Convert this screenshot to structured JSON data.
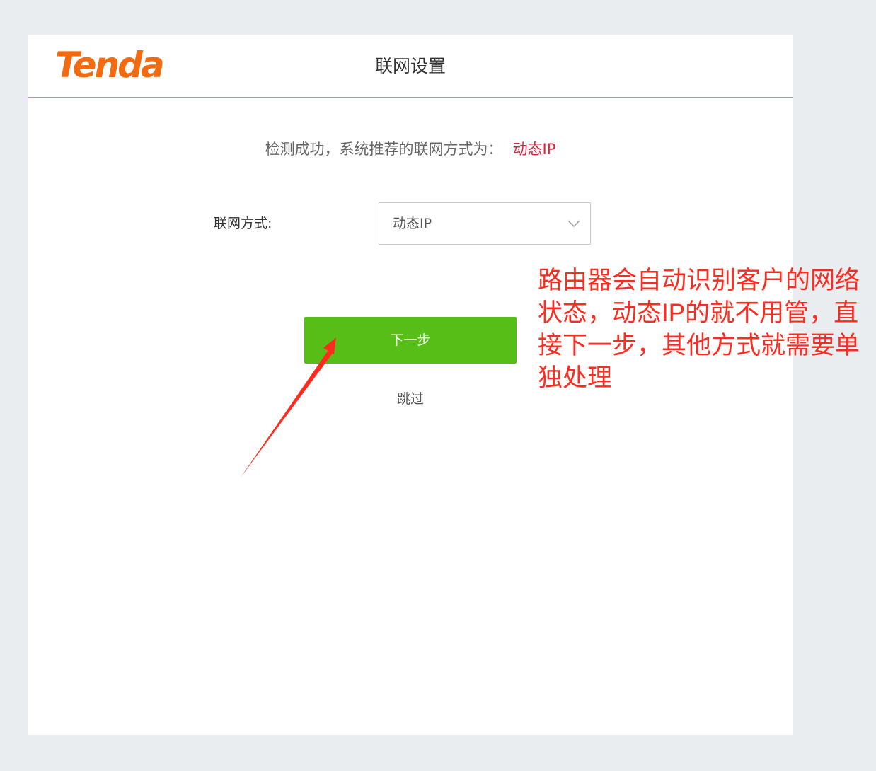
{
  "header": {
    "logo_text": "Tenda",
    "title": "联网设置"
  },
  "main": {
    "detect_message": "检测成功，系统推荐的联网方式为：",
    "detect_result": "动态IP",
    "connection_label": "联网方式:",
    "connection_value": "动态IP",
    "next_button": "下一步",
    "skip_link": "跳过"
  },
  "annotation": {
    "text": "路由器会自动识别客户的网络状态，动态IP的就不用管，直接下一步，其他方式就需要单独处理"
  },
  "colors": {
    "page_background": "#e9edf0",
    "brand_orange": "#f26b10",
    "header_border": "#f08a33",
    "accent_red": "#d9233f",
    "button_green": "#56be17",
    "annotation_red": "#ff2b1f"
  },
  "icons": {
    "select_arrow": "chevron-down-icon",
    "annotation_arrow": "arrow-icon"
  }
}
